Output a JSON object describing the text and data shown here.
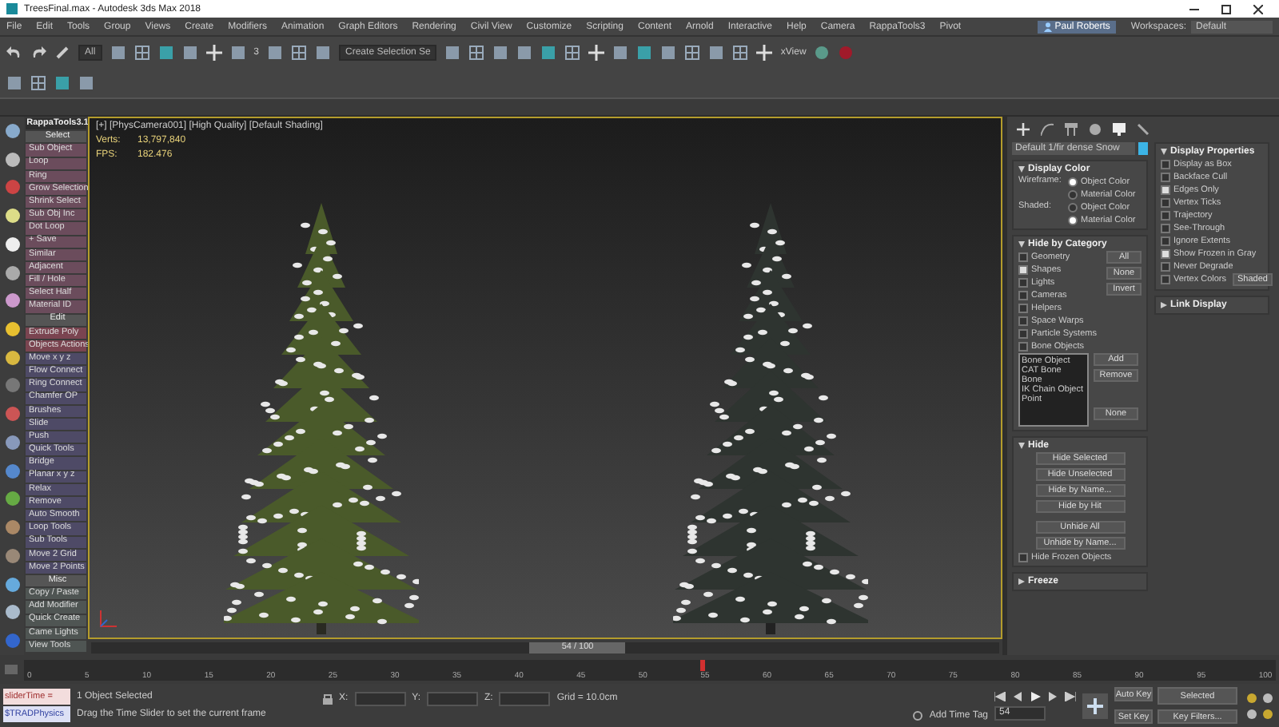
{
  "window": {
    "title": "TreesFinal.max - Autodesk 3ds Max 2018"
  },
  "menu": [
    "File",
    "Edit",
    "Tools",
    "Group",
    "Views",
    "Create",
    "Modifiers",
    "Animation",
    "Graph Editors",
    "Rendering",
    "Civil View",
    "Customize",
    "Scripting",
    "Content",
    "Arnold",
    "Interactive",
    "Help",
    "Camera",
    "RappaTools3",
    "Pivot"
  ],
  "user": "Paul Roberts",
  "workspace": {
    "label": "Workspaces:",
    "value": "Default"
  },
  "toolbar": {
    "selection_filter": "All",
    "selection_set": "Create Selection Se",
    "snap": "3",
    "xview": "xView"
  },
  "rappa_tools": {
    "title": "RappaTools3.1",
    "items": [
      {
        "label": "Select",
        "kind": "header"
      },
      {
        "label": "Sub Object",
        "kind": "tool",
        "color": "#6b4c5c"
      },
      {
        "label": "Loop",
        "kind": "tool",
        "color": "#6b4c5c"
      },
      {
        "label": "Ring",
        "kind": "tool",
        "color": "#6b4c5c"
      },
      {
        "label": "Grow Selection",
        "kind": "tool",
        "color": "#6b4c5c"
      },
      {
        "label": "Shrink Select",
        "kind": "tool",
        "color": "#6b4c5c"
      },
      {
        "label": "Sub Obj Inc",
        "kind": "tool",
        "color": "#6b4c5c"
      },
      {
        "label": "Dot Loop",
        "kind": "tool",
        "color": "#6b4c5c"
      },
      {
        "label": "+ Save",
        "kind": "tool",
        "color": "#6b4c5c"
      },
      {
        "label": "Similar",
        "kind": "tool",
        "color": "#6b4c5c"
      },
      {
        "label": "Adjacent",
        "kind": "tool",
        "color": "#6b4c5c"
      },
      {
        "label": "Fill / Hole",
        "kind": "tool",
        "color": "#6b4c5c"
      },
      {
        "label": "Select Half",
        "kind": "tool",
        "color": "#6b4c5c"
      },
      {
        "label": "Material ID",
        "kind": "tool",
        "color": "#6b4c5c"
      },
      {
        "label": "Edit",
        "kind": "header"
      },
      {
        "label": "Extrude Poly",
        "kind": "tool",
        "color": "#7a4450"
      },
      {
        "label": "Objects Actions",
        "kind": "tool",
        "color": "#7a4450"
      },
      {
        "label": "Move  x  y  z",
        "kind": "tool",
        "color": "#4e4a66"
      },
      {
        "label": "Flow Connect",
        "kind": "tool",
        "color": "#4e4a66"
      },
      {
        "label": "Ring Connect",
        "kind": "tool",
        "color": "#4e4a66"
      },
      {
        "label": "Chamfer OP",
        "kind": "tool",
        "color": "#4e4a66"
      },
      {
        "label": "Brushes",
        "kind": "tool",
        "color": "#4e4a66"
      },
      {
        "label": "Slide",
        "kind": "tool",
        "color": "#4e4a66"
      },
      {
        "label": "Push",
        "kind": "tool",
        "color": "#4e4a66"
      },
      {
        "label": "Quick Tools",
        "kind": "tool",
        "color": "#4e4a66"
      },
      {
        "label": "Bridge",
        "kind": "tool",
        "color": "#4e4a66"
      },
      {
        "label": "Planar x y z",
        "kind": "tool",
        "color": "#4e4a66"
      },
      {
        "label": "Relax",
        "kind": "tool",
        "color": "#4e4a66"
      },
      {
        "label": "Remove",
        "kind": "tool",
        "color": "#4e4a66"
      },
      {
        "label": "Auto Smooth",
        "kind": "tool",
        "color": "#4e4a66"
      },
      {
        "label": "Loop Tools",
        "kind": "tool",
        "color": "#4e4a66"
      },
      {
        "label": "Sub Tools",
        "kind": "tool",
        "color": "#4e4a66"
      },
      {
        "label": "Move 2 Grid",
        "kind": "tool",
        "color": "#4e4a66"
      },
      {
        "label": "Move 2 Points",
        "kind": "tool",
        "color": "#4e4a66"
      },
      {
        "label": "Misc",
        "kind": "header"
      },
      {
        "label": "Copy / Paste",
        "kind": "tool",
        "color": "#4f5553"
      },
      {
        "label": "Add Modifier",
        "kind": "tool",
        "color": "#4f5553"
      },
      {
        "label": "Quick Create",
        "kind": "tool",
        "color": "#4f5553"
      },
      {
        "label": "Came Lights",
        "kind": "tool",
        "color": "#4f5553"
      },
      {
        "label": "View Tools",
        "kind": "tool",
        "color": "#4f5553"
      }
    ]
  },
  "viewport": {
    "label": "[+] [PhysCamera001] [High Quality] [Default Shading]",
    "stats": [
      {
        "name": "Verts:",
        "value": "13,797,840"
      },
      {
        "name": "FPS:",
        "value": "182.476"
      }
    ]
  },
  "time_slider": {
    "reading": "54 / 100",
    "level": 0.54
  },
  "command_panel": {
    "object_name": "Default 1/fir dense Snow",
    "display_color": {
      "title": "Display Color",
      "groups": [
        {
          "label": "Wireframe:",
          "options": [
            {
              "label": "Object Color",
              "selected": true
            },
            {
              "label": "Material Color",
              "selected": false
            }
          ]
        },
        {
          "label": "Shaded:",
          "options": [
            {
              "label": "Object Color",
              "selected": false
            },
            {
              "label": "Material Color",
              "selected": true
            }
          ]
        }
      ]
    },
    "hide_by_category": {
      "title": "Hide by Category",
      "categories": [
        {
          "label": "Geometry",
          "checked": false
        },
        {
          "label": "Shapes",
          "checked": true
        },
        {
          "label": "Lights",
          "checked": false
        },
        {
          "label": "Cameras",
          "checked": false
        },
        {
          "label": "Helpers",
          "checked": false
        },
        {
          "label": "Space Warps",
          "checked": false
        },
        {
          "label": "Particle Systems",
          "checked": false
        },
        {
          "label": "Bone Objects",
          "checked": false
        }
      ],
      "buttons": [
        "All",
        "None",
        "Invert"
      ],
      "list": [
        "Bone Object",
        "CAT Bone",
        "Bone",
        "IK Chain Object",
        "Point"
      ],
      "list_buttons": [
        "Add",
        "Remove",
        "None"
      ]
    },
    "hide": {
      "title": "Hide",
      "buttons": [
        "Hide Selected",
        "Hide Unselected",
        "Hide by Name...",
        "Hide by Hit",
        "Unhide All",
        "Unhide by Name..."
      ],
      "frozen": {
        "label": "Hide Frozen Objects",
        "checked": false
      }
    },
    "freeze": {
      "title": "Freeze"
    },
    "display_properties": {
      "title": "Display Properties",
      "options": [
        {
          "label": "Display as Box",
          "checked": false
        },
        {
          "label": "Backface Cull",
          "checked": false
        },
        {
          "label": "Edges Only",
          "checked": true
        },
        {
          "label": "Vertex Ticks",
          "checked": false
        },
        {
          "label": "Trajectory",
          "checked": false
        },
        {
          "label": "See-Through",
          "checked": false
        },
        {
          "label": "Ignore Extents",
          "checked": false
        },
        {
          "label": "Show Frozen in Gray",
          "checked": true
        },
        {
          "label": "Never Degrade",
          "checked": false
        },
        {
          "label": "Vertex Colors",
          "checked": false
        }
      ],
      "shaded_button": "Shaded"
    },
    "link_display": {
      "title": "Link Display"
    }
  },
  "timeline": {
    "ticks": [
      "0",
      "5",
      "10",
      "15",
      "20",
      "25",
      "30",
      "35",
      "40",
      "45",
      "50",
      "55",
      "60",
      "65",
      "70",
      "75",
      "80",
      "85",
      "90",
      "95",
      "100"
    ],
    "level": 0.54
  },
  "status": {
    "listener": [
      "sliderTime =",
      "$TRADPhysics"
    ],
    "selection": "1 Object Selected",
    "prompt": "Drag the Time Slider to set the current frame",
    "coords": [
      "X:",
      "Y:",
      "Z:"
    ],
    "grid": "Grid = 10.0cm",
    "time_tag": "Add Time Tag",
    "frame": "54",
    "auto_key": "Auto Key",
    "key_mode": "Selected",
    "set_key": "Set Key",
    "key_filters": "Key Filters..."
  }
}
